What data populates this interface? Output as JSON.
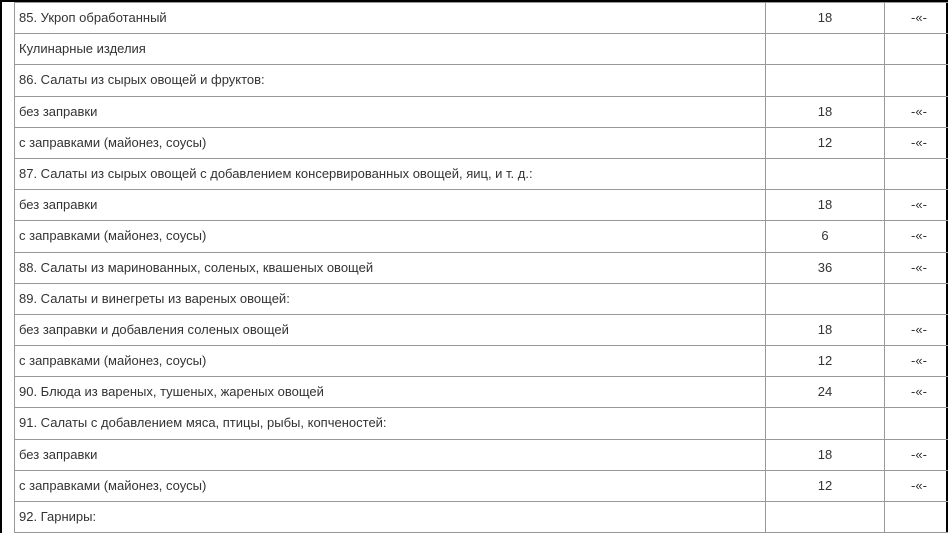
{
  "table": {
    "rows": [
      {
        "name": "85. Укроп обработанный",
        "col2": "18",
        "col3": "-«-"
      },
      {
        "name": "Кулинарные изделия",
        "col2": "",
        "col3": ""
      },
      {
        "name": "86. Салаты из сырых овощей и фруктов:",
        "col2": "",
        "col3": ""
      },
      {
        "name": "без заправки",
        "col2": "18",
        "col3": "-«-"
      },
      {
        "name": "с заправками (майонез, соусы)",
        "col2": "12",
        "col3": "-«-"
      },
      {
        "name": "87. Салаты из сырых овощей с добавлением консервированных овощей, яиц, и т. д.:",
        "col2": "",
        "col3": ""
      },
      {
        "name": "без заправки",
        "col2": "18",
        "col3": "-«-"
      },
      {
        "name": "с заправками (майонез, соусы)",
        "col2": "6",
        "col3": "-«-"
      },
      {
        "name": "88. Салаты из маринованных, соленых, квашеных овощей",
        "col2": "36",
        "col3": "-«-"
      },
      {
        "name": "89. Салаты и винегреты из вареных овощей:",
        "col2": "",
        "col3": ""
      },
      {
        "name": "без заправки и добавления соленых овощей",
        "col2": "18",
        "col3": "-«-"
      },
      {
        "name": "с заправками (майонез, соусы)",
        "col2": "12",
        "col3": "-«-"
      },
      {
        "name": "90. Блюда из вареных, тушеных, жареных овощей",
        "col2": "24",
        "col3": "-«-"
      },
      {
        "name": "91. Салаты с добавлением мяса, птицы, рыбы, копченостей:",
        "col2": "",
        "col3": ""
      },
      {
        "name": "без заправки",
        "col2": "18",
        "col3": "-«-"
      },
      {
        "name": "с заправками (майонез, соусы)",
        "col2": "12",
        "col3": "-«-"
      },
      {
        "name": "92. Гарниры:",
        "col2": "",
        "col3": ""
      }
    ]
  }
}
